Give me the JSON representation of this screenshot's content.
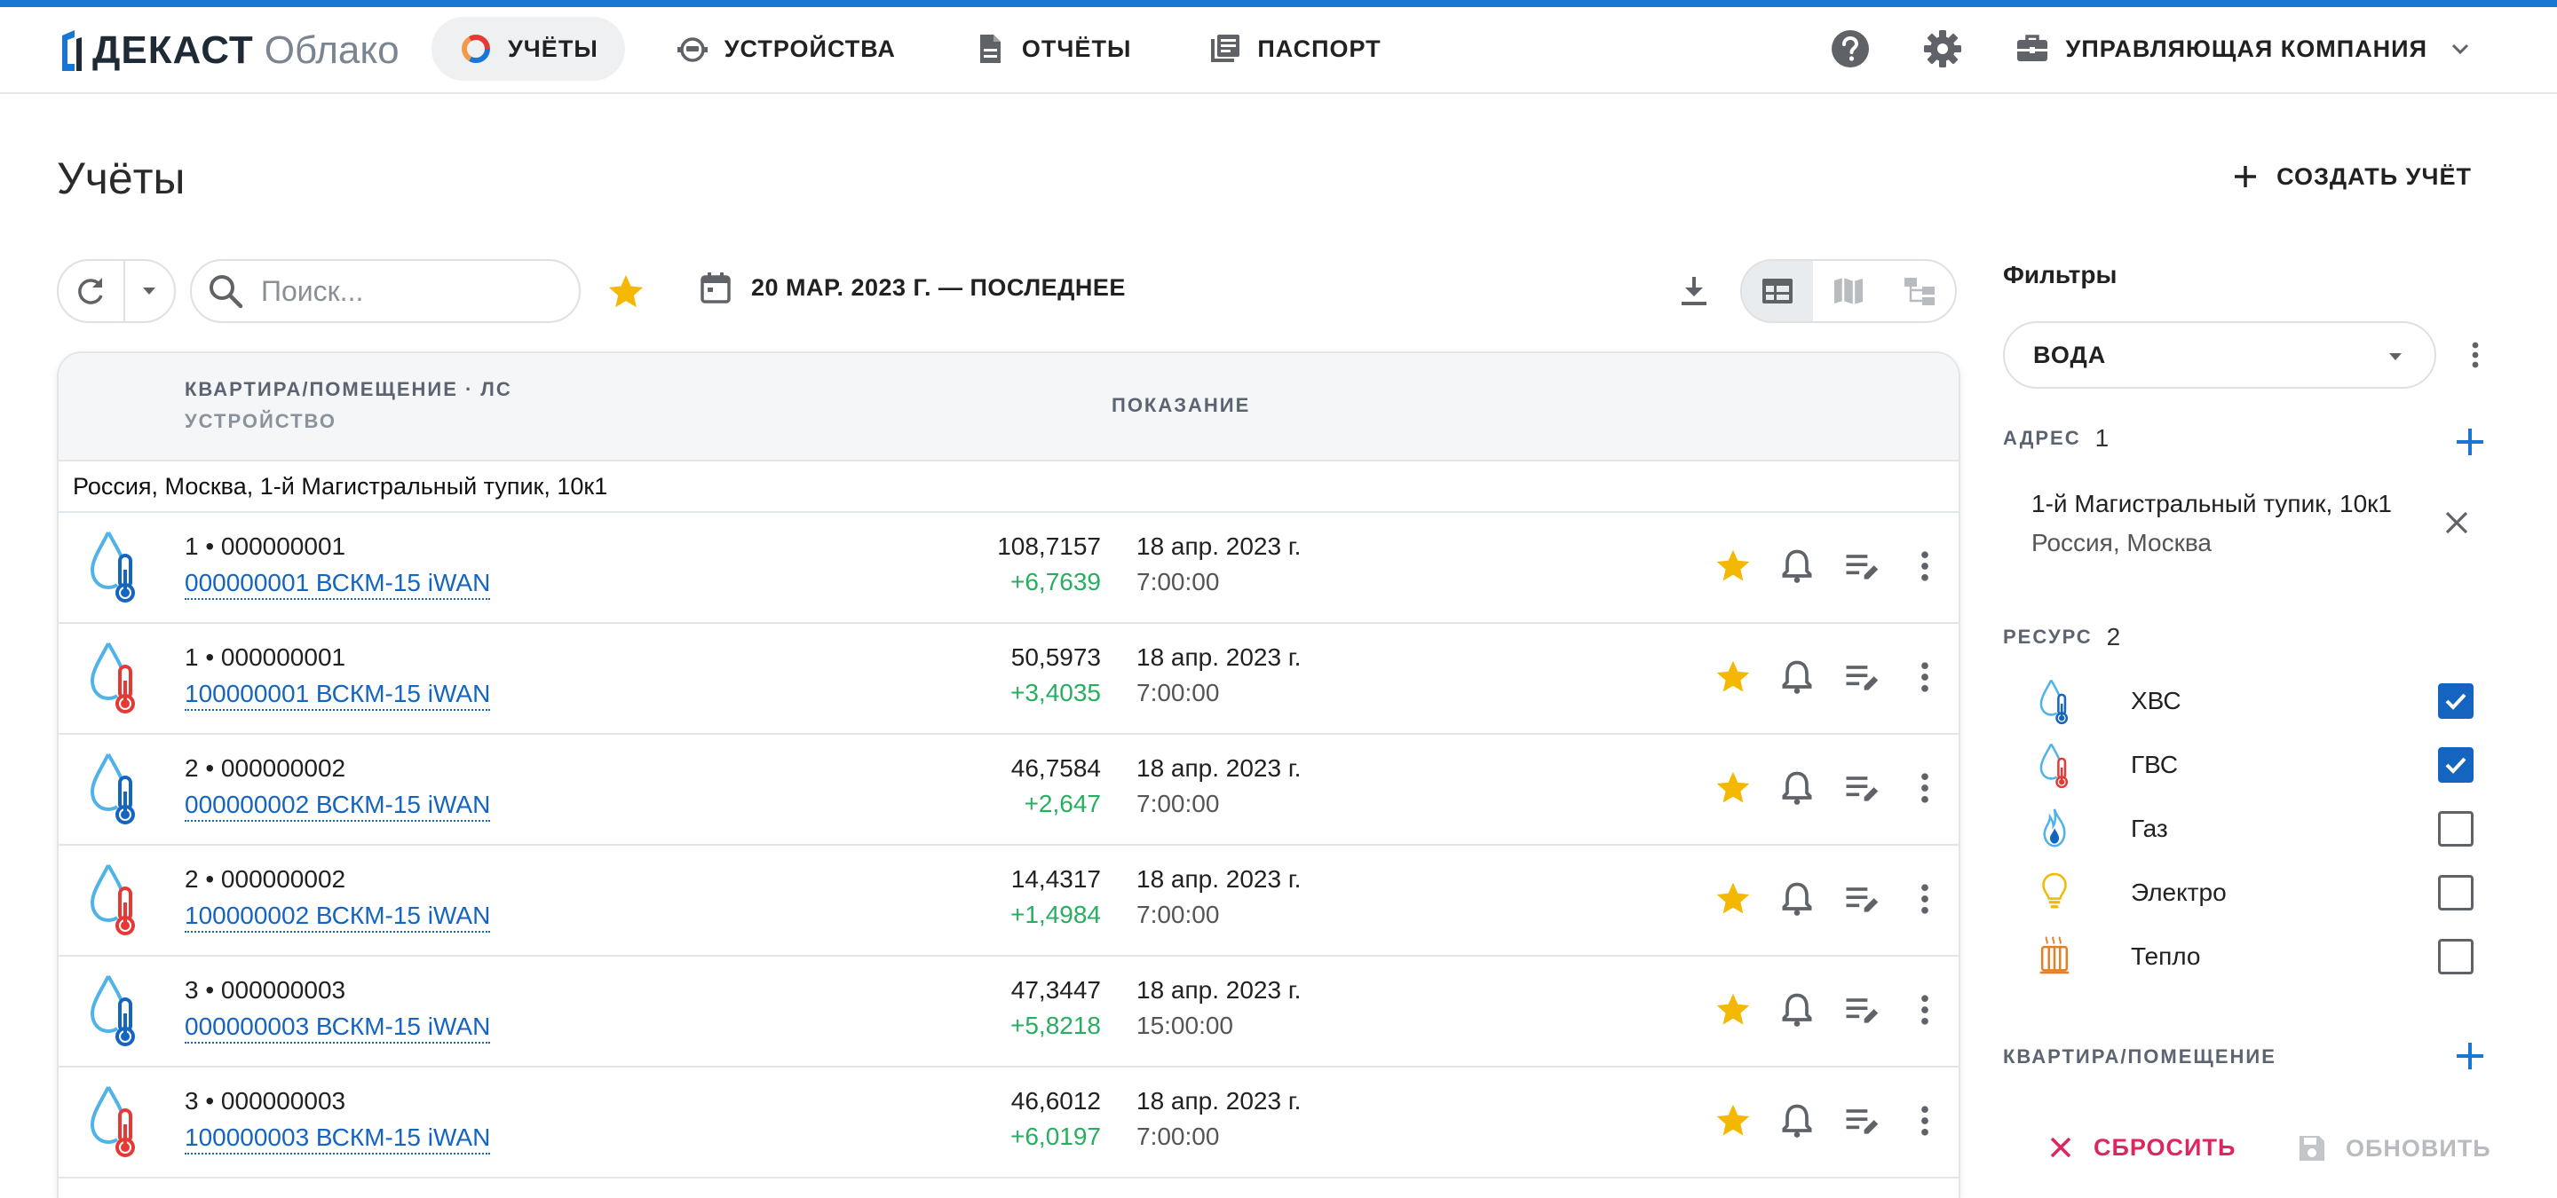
{
  "app": {
    "brand": "ДЕКАСТ",
    "product": "Облако",
    "accent": "#1976d2"
  },
  "nav": [
    {
      "label": "УЧЁТЫ",
      "icon": "accounting-pie-icon",
      "active": true
    },
    {
      "label": "УСТРОЙСТВА",
      "icon": "device-meter-icon",
      "active": false
    },
    {
      "label": "ОТЧЁТЫ",
      "icon": "document-icon",
      "active": false
    },
    {
      "label": "ПАСПОРТ",
      "icon": "passport-book-icon",
      "active": false
    }
  ],
  "header": {
    "help_icon": "help-icon",
    "settings_icon": "gear-icon",
    "company": "УПРАВЛЯЮЩАЯ КОМПАНИЯ"
  },
  "page": {
    "title": "Учёты",
    "create_label": "СОЗДАТЬ УЧЁТ"
  },
  "toolbar": {
    "search_placeholder": "Поиск...",
    "date_range": "20 МАР. 2023 Г. — ПОСЛЕДНЕЕ",
    "active_view": "table"
  },
  "table": {
    "col1_line1": "КВАРТИРА/ПОМЕЩЕНИЕ · ЛС",
    "col1_line2": "УСТРОЙСТВО",
    "col2": "ПОКАЗАНИЕ",
    "group": "Россия, Москва, 1-й Магистральный тупик, 10к1",
    "rows": [
      {
        "apt": "1  •  000000001",
        "device": "000000001 ВСКМ-15 iWAN",
        "value": "108,7157",
        "delta": "+6,7639",
        "date": "18 апр. 2023 г.",
        "time": "7:00:00",
        "resource": "cold",
        "favorite": true
      },
      {
        "apt": "1  •  000000001",
        "device": "100000001 ВСКМ-15 iWAN",
        "value": "50,5973",
        "delta": "+3,4035",
        "date": "18 апр. 2023 г.",
        "time": "7:00:00",
        "resource": "hot",
        "favorite": true
      },
      {
        "apt": "2  •  000000002",
        "device": "000000002 ВСКМ-15 iWAN",
        "value": "46,7584",
        "delta": "+2,647",
        "date": "18 апр. 2023 г.",
        "time": "7:00:00",
        "resource": "cold",
        "favorite": true
      },
      {
        "apt": "2  •  000000002",
        "device": "100000002 ВСКМ-15 iWAN",
        "value": "14,4317",
        "delta": "+1,4984",
        "date": "18 апр. 2023 г.",
        "time": "7:00:00",
        "resource": "hot",
        "favorite": true
      },
      {
        "apt": "3  •  000000003",
        "device": "000000003 ВСКМ-15 iWAN",
        "value": "47,3447",
        "delta": "+5,8218",
        "date": "18 апр. 2023 г.",
        "time": "15:00:00",
        "resource": "cold",
        "favorite": true
      },
      {
        "apt": "3  •  000000003",
        "device": "100000003 ВСКМ-15 iWAN",
        "value": "46,6012",
        "delta": "+6,0197",
        "date": "18 апр. 2023 г.",
        "time": "7:00:00",
        "resource": "hot",
        "favorite": true
      }
    ]
  },
  "filters": {
    "title": "Фильтры",
    "preset": "ВОДА",
    "address_label": "АДРЕС",
    "address_count": "1",
    "address_line1": "1-й Магистральный тупик, 10к1",
    "address_line2": "Россия, Москва",
    "resource_label": "РЕСУРС",
    "resource_count": "2",
    "resources": [
      {
        "label": "ХВС",
        "icon": "cold-water-icon",
        "checked": true
      },
      {
        "label": "ГВС",
        "icon": "hot-water-icon",
        "checked": true
      },
      {
        "label": "Газ",
        "icon": "gas-flame-icon",
        "checked": false
      },
      {
        "label": "Электро",
        "icon": "bulb-icon",
        "checked": false
      },
      {
        "label": "Тепло",
        "icon": "radiator-icon",
        "checked": false
      }
    ],
    "apartment_label": "КВАРТИРА/ПОМЕЩЕНИЕ",
    "reset_label": "СБРОСИТЬ",
    "update_label": "ОБНОВИТЬ"
  }
}
